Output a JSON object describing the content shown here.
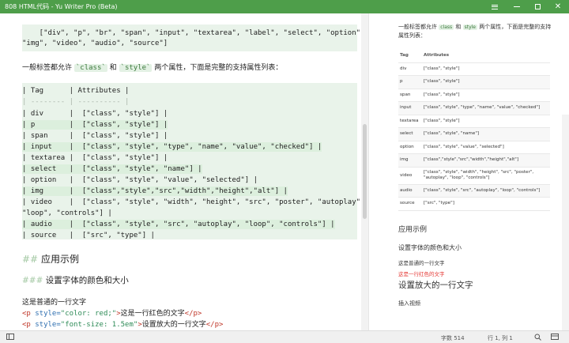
{
  "window": {
    "title": "808 HTML代码 - Yu Writer Pro (Beta)",
    "buttons": [
      "menu-icon",
      "minimize-icon",
      "maximize-icon",
      "close-icon"
    ]
  },
  "editor": {
    "top_code": [
      "    [\"div\", \"p\", \"br\", \"span\", \"input\", \"textarea\", \"label\", \"select\", \"option\",",
      "\"img\", \"video\", \"audio\", \"source\"]"
    ],
    "intro_pre": "一般标签都允许 ",
    "intro_code1": "`class`",
    "intro_mid": " 和 ",
    "intro_code2": "`style`",
    "intro_post": " 两个属性，下面是完整的支持属性列表：",
    "table_lines": [
      "| Tag      | Attributes |",
      "| -------- | ---------- |",
      "| div      |  [\"class\", \"style\"] |",
      "| p        |  [\"class\", \"style\"] |",
      "| span     |  [\"class\", \"style\"] |",
      "| input    |  [\"class\", \"style\", \"type\", \"name\", \"value\", \"checked\"] |",
      "| textarea |  [\"class\", \"style\"] |",
      "| select   |  [\"class\", \"style\", \"name\"] |",
      "| option   |  [\"class\", \"style\", \"value\", \"selected\"] |",
      "| img      |  [\"class\",\"style\",\"src\",\"width\",\"height\",\"alt\"] |",
      "| video    |  [\"class\", \"style\", \"width\", \"height\", \"src\", \"poster\", \"autoplay\",",
      "\"loop\", \"controls\"] |",
      "| audio    |  [\"class\", \"style\", \"src\", \"autoplay\", \"loop\", \"controls\"] |",
      "| source   |  [\"src\", \"type\"] |"
    ],
    "h2_mark": "##",
    "h2_text": "应用示例",
    "h3_mark": "###",
    "h3_text": "设置字体的颜色和大小",
    "plain_line": "这是普通的一行文字",
    "html_line1": {
      "open": "<p",
      "attr": " style=",
      "val": "\"color: red;\"",
      "close": ">",
      "text": "这是一行红色的文字",
      "end": "</p>"
    },
    "html_line2": {
      "open": "<p",
      "attr": " style=",
      "val": "\"font-size: 1.5em\"",
      "close": ">",
      "text": "设置放大的一行文字",
      "end": "</p>"
    }
  },
  "preview": {
    "intro": "一般标签都允许 class 和 style 两个属性，下面是完整的支持属性列表：",
    "intro_pre": "一般标签都允许",
    "intro_code1": "class",
    "intro_mid": "和",
    "intro_code2": "style",
    "intro_post": "两个属性，下面是完整的支持属性列表：",
    "table_headers": [
      "Tag",
      "Attributes"
    ],
    "table_rows": [
      [
        "div",
        "[\"class\", \"style\"]"
      ],
      [
        "p",
        "[\"class\", \"style\"]"
      ],
      [
        "span",
        "[\"class\", \"style\"]"
      ],
      [
        "input",
        "[\"class\", \"style\", \"type\", \"name\", \"value\", \"checked\"]"
      ],
      [
        "textarea",
        "[\"class\", \"style\"]"
      ],
      [
        "select",
        "[\"class\", \"style\", \"name\"]"
      ],
      [
        "option",
        "[\"class\", \"style\", \"value\", \"selected\"]"
      ],
      [
        "img",
        "[\"class\",\"style\",\"src\",\"width\",\"height\",\"alt\"]"
      ],
      [
        "video",
        "[\"class\", \"style\", \"width\", \"height\", \"src\", \"poster\", \"autoplay\", \"loop\", \"controls\"]"
      ],
      [
        "audio",
        "[\"class\", \"style\", \"src\", \"autoplay\", \"loop\", \"controls\"]"
      ],
      [
        "source",
        "[\"src\", \"type\"]"
      ]
    ],
    "h2": "应用示例",
    "h3": "设置字体的颜色和大小",
    "plain": "这是普通的一行文字",
    "red": "这是一行红色的文字",
    "big": "设置放大的一行文字",
    "insert_video": "插入视频"
  },
  "statusbar": {
    "word_count": "字数 514",
    "cursor": "行 1, 列 1"
  },
  "colors": {
    "titlebar": "#4e9e4a",
    "code_bg": "#e9f3ea",
    "red_text": "#e53935"
  }
}
